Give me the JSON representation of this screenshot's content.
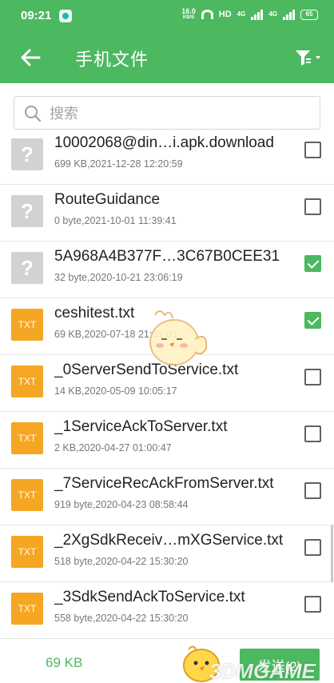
{
  "status_bar": {
    "time": "09:21",
    "net_speed": "16.0",
    "net_speed_unit": "KB/S",
    "hd_label": "HD",
    "signal_1_label": "4G",
    "signal_2_label": "4G",
    "battery": "65"
  },
  "app_bar": {
    "title": "手机文件",
    "back_icon": "arrow-left-icon",
    "filter_icon": "filter-icon"
  },
  "search": {
    "placeholder": "搜索",
    "value": ""
  },
  "files": [
    {
      "name": "10002068@din…i.apk.download",
      "meta": "699 KB,2021-12-28 12:20:59",
      "icon": "?",
      "type": "unknown",
      "checked": false
    },
    {
      "name": "RouteGuidance",
      "meta": "0 byte,2021-10-01 11:39:41",
      "icon": "?",
      "type": "unknown",
      "checked": false
    },
    {
      "name": "5A968A4B377F…3C67B0CEE31",
      "meta": "32 byte,2020-10-21 23:06:19",
      "icon": "?",
      "type": "unknown",
      "checked": true
    },
    {
      "name": "ceshitest.txt",
      "meta": "69 KB,2020-07-18 21:31:03",
      "icon": "TXT",
      "type": "txt",
      "checked": true
    },
    {
      "name": "_0ServerSendToService.txt",
      "meta": "14 KB,2020-05-09 10:05:17",
      "icon": "TXT",
      "type": "txt",
      "checked": false
    },
    {
      "name": "_1ServiceAckToServer.txt",
      "meta": "2 KB,2020-04-27 01:00:47",
      "icon": "TXT",
      "type": "txt",
      "checked": false
    },
    {
      "name": "_7ServiceRecAckFromServer.txt",
      "meta": "919 byte,2020-04-23 08:58:44",
      "icon": "TXT",
      "type": "txt",
      "checked": false
    },
    {
      "name": "_2XgSdkReceiv…mXGService.txt",
      "meta": "518 byte,2020-04-22 15:30:20",
      "icon": "TXT",
      "type": "txt",
      "checked": false
    },
    {
      "name": "_3SdkSendAckToService.txt",
      "meta": "558 byte,2020-04-22 15:30:20",
      "icon": "TXT",
      "type": "txt",
      "checked": false
    }
  ],
  "bottom_bar": {
    "total_size": "69 KB",
    "send_label": "发送(2)"
  },
  "watermark": "3DMGAME",
  "colors": {
    "primary_green": "#4cb860",
    "txt_orange": "#f5a623",
    "unknown_gray": "#d2d2d2"
  }
}
